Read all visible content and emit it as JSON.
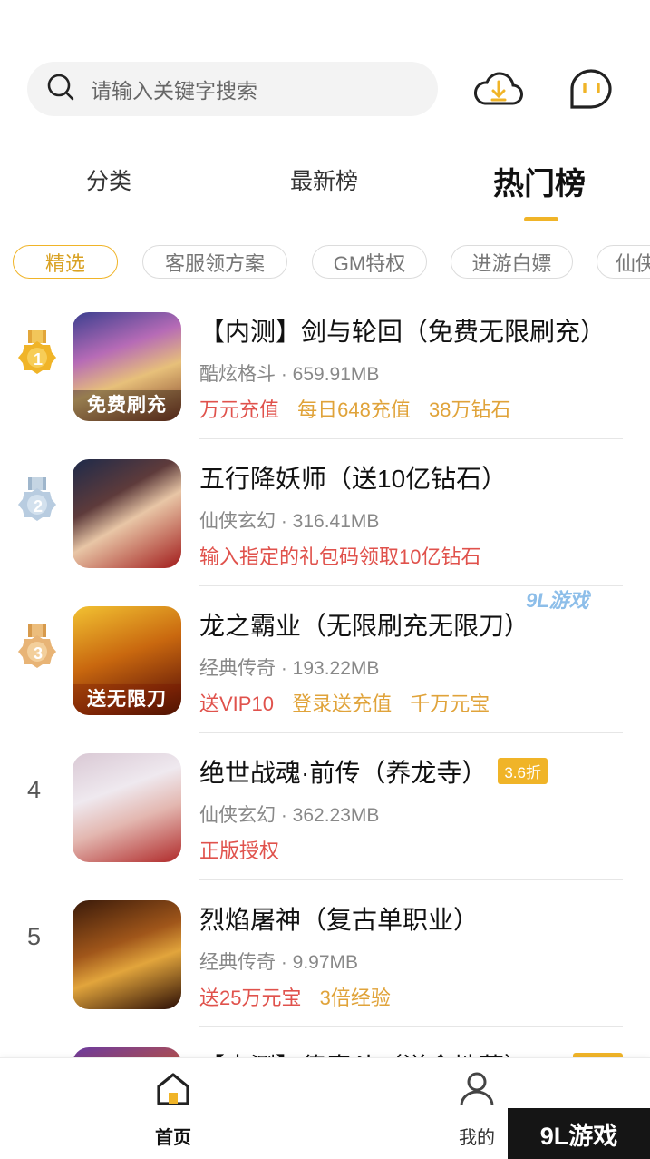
{
  "search": {
    "placeholder": "请输入关键字搜索"
  },
  "tabs": [
    {
      "label": "分类"
    },
    {
      "label": "最新榜"
    },
    {
      "label": "热门榜"
    }
  ],
  "chips": [
    "精选",
    "客服领方案",
    "GM特权",
    "进游白嫖",
    "仙侠"
  ],
  "games": [
    {
      "rank": "1",
      "title": "【内测】剑与轮回（免费无限刷充）",
      "meta": "酷炫格斗 · 659.91MB",
      "tags": [
        {
          "text": "万元充值",
          "color": "#e0524c"
        },
        {
          "text": "每日648充值",
          "color": "#e0a33a"
        },
        {
          "text": "38万钻石",
          "color": "#e0a33a"
        }
      ],
      "icon_band": "免费刷充"
    },
    {
      "rank": "2",
      "title": "五行降妖师（送10亿钻石）",
      "meta": "仙侠玄幻 · 316.41MB",
      "tags": [
        {
          "text": "输入指定的礼包码领取10亿钻石",
          "color": "#e0524c"
        }
      ],
      "icon_band": ""
    },
    {
      "rank": "3",
      "title": "龙之霸业（无限刷充无限刀）",
      "meta": "经典传奇 · 193.22MB",
      "tags": [
        {
          "text": "送VIP10",
          "color": "#e0524c"
        },
        {
          "text": "登录送充值",
          "color": "#e0a33a"
        },
        {
          "text": "千万元宝",
          "color": "#e0a33a"
        }
      ],
      "icon_band": "送无限刀"
    },
    {
      "rank": "4",
      "title": "绝世战魂·前传（养龙寺）",
      "discount": "3.6折",
      "meta": "仙侠玄幻 · 362.23MB",
      "tags": [
        {
          "text": "正版授权",
          "color": "#e0524c"
        }
      ],
      "icon_band": ""
    },
    {
      "rank": "5",
      "title": "烈焰屠神（复古单职业）",
      "meta": "经典传奇 · 9.97MB",
      "tags": [
        {
          "text": "送25万元宝",
          "color": "#e0524c"
        },
        {
          "text": "3倍经验",
          "color": "#e0a33a"
        }
      ],
      "icon_band": ""
    },
    {
      "rank": "",
      "title": "【内测】传奇斗（送金地藏）",
      "meta": "",
      "tags": [],
      "icon_band": ""
    }
  ],
  "bottom_nav": [
    {
      "label": "首页",
      "icon": "home-icon"
    },
    {
      "label": "我的",
      "icon": "user-icon"
    }
  ],
  "watermark": "9L游戏",
  "colors": {
    "accent": "#f0b428",
    "tag_red": "#e0524c",
    "tag_gold": "#e0a33a"
  }
}
